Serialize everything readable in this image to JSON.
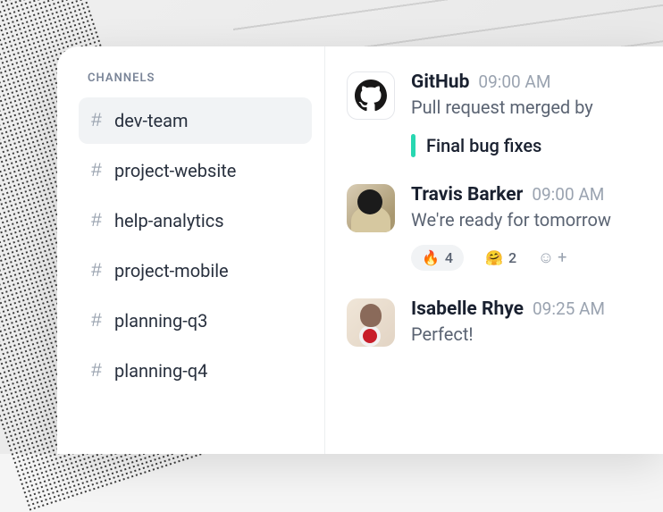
{
  "sidebar": {
    "header": "CHANNELS",
    "items": [
      {
        "label": "dev-team",
        "selected": true
      },
      {
        "label": "project-website",
        "selected": false
      },
      {
        "label": "help-analytics",
        "selected": false
      },
      {
        "label": "project-mobile",
        "selected": false
      },
      {
        "label": "planning-q3",
        "selected": false
      },
      {
        "label": "planning-q4",
        "selected": false
      }
    ]
  },
  "messages": [
    {
      "sender": "GitHub",
      "time": "09:00 AM",
      "text": "Pull request merged by",
      "avatar": "github",
      "attachment": {
        "color": "#28d7b1",
        "title": "Final bug fixes"
      }
    },
    {
      "sender": "Travis Barker",
      "time": "09:00 AM",
      "text": "We're ready for tomorrow",
      "avatar": "photo-1",
      "reactions": [
        {
          "emoji": "🔥",
          "count": "4",
          "bg": true
        },
        {
          "emoji": "🤗",
          "count": "2",
          "bg": false
        }
      ]
    },
    {
      "sender": "Isabelle Rhye",
      "time": "09:25 AM",
      "text": "Perfect!",
      "avatar": "photo-2"
    }
  ],
  "icons": {
    "hash": "#",
    "add_reaction_face": "☺",
    "add_reaction_plus": "+"
  }
}
